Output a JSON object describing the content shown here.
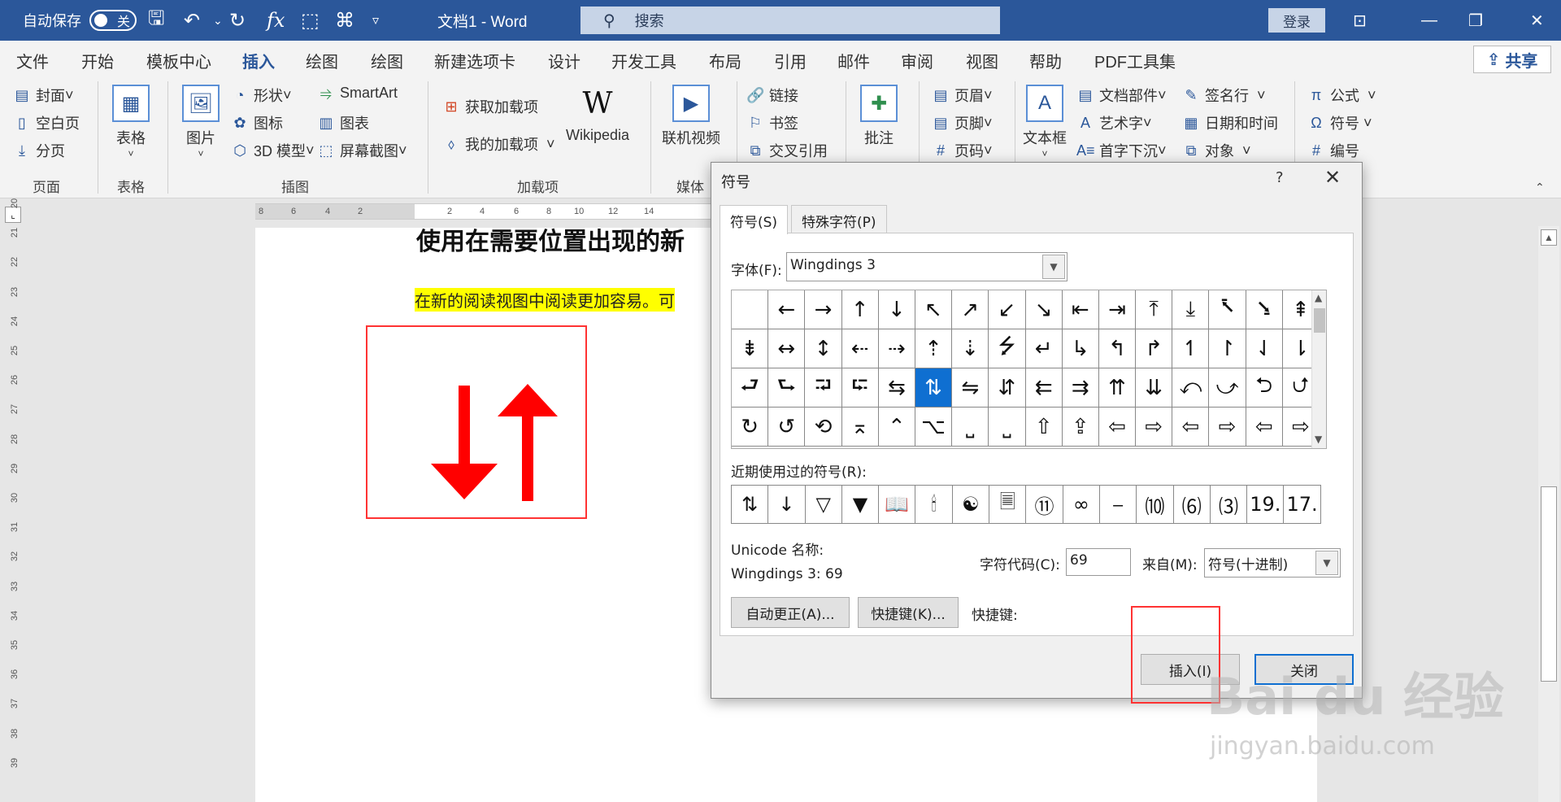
{
  "titlebar": {
    "autosave_label": "自动保存",
    "autosave_state": "关",
    "doc_title": "文档1  -  Word",
    "search_placeholder": "搜索",
    "login_label": "登录"
  },
  "tabs": [
    "文件",
    "开始",
    "模板中心",
    "插入",
    "绘图",
    "绘图",
    "新建选项卡",
    "设计",
    "开发工具",
    "布局",
    "引用",
    "邮件",
    "审阅",
    "视图",
    "帮助",
    "PDF工具集"
  ],
  "active_tab": "插入",
  "share_label": "共享",
  "ribbon": {
    "pages": {
      "cover": "封面",
      "blank": "空白页",
      "break": "分页",
      "group": "页面"
    },
    "tables": {
      "table": "表格",
      "group": "表格"
    },
    "illustrations": {
      "picture": "图片",
      "shapes": "形状",
      "icons": "图标",
      "model3d": "3D 模型",
      "smartart": "SmartArt",
      "chart": "图表",
      "screenshot": "屏幕截图",
      "group": "插图"
    },
    "addins": {
      "get": "获取加载项",
      "my": "我的加载项",
      "wikipedia": "Wikipedia",
      "group": "加载项"
    },
    "media": {
      "video": "联机视频",
      "group": "媒体"
    },
    "links": {
      "link": "链接",
      "bookmark": "书签",
      "crossref": "交叉引用"
    },
    "comments": {
      "comment": "批注"
    },
    "headerfooter": {
      "header": "页眉",
      "footer": "页脚",
      "pagenum": "页码"
    },
    "text": {
      "textbox": "文本框",
      "quickparts": "文档部件",
      "wordart": "艺术字",
      "dropcap": "首字下沉",
      "sigline": "签名行",
      "datetime": "日期和时间",
      "object": "对象"
    },
    "symbols": {
      "equation": "公式",
      "symbol": "符号",
      "number": "编号"
    }
  },
  "document": {
    "heading": "使用在需要位置出现的新",
    "highlighted_text": "在新的阅读视图中阅读更加容易。可"
  },
  "vruler_numbers": [
    "20",
    "21",
    "22",
    "23",
    "24",
    "25",
    "26",
    "27",
    "28",
    "29",
    "30",
    "31",
    "32",
    "33",
    "34",
    "35",
    "36",
    "37",
    "38",
    "39"
  ],
  "hruler_numbers": [
    "8",
    "6",
    "4",
    "2",
    "2",
    "4",
    "6",
    "8",
    "10",
    "12",
    "14"
  ],
  "dialog": {
    "title": "符号",
    "help": "?",
    "tab_symbols": "符号(S)",
    "tab_special": "特殊字符(P)",
    "font_label": "字体(F):",
    "font_value": "Wingdings 3",
    "symbols": [
      "",
      "←",
      "→",
      "↑",
      "↓",
      "↖",
      "↗",
      "↙",
      "↘",
      "⇤",
      "⇥",
      "⤒",
      "⤓",
      "⭶",
      "⭸",
      "⇞",
      "⇟",
      "↔",
      "↕",
      "⇠",
      "⇢",
      "⇡",
      "⇣",
      "⭍",
      "↵",
      "↳",
      "↰",
      "↱",
      "↿",
      "↾",
      "⇃",
      "⇂",
      "⮐",
      "⮑",
      "⮒",
      "⮓",
      "⇆",
      "⇅",
      "⇋",
      "⇵",
      "⇇",
      "⇉",
      "⇈",
      "⇊",
      "⤺",
      "⤻",
      "⮌",
      "⮍",
      "↻",
      "↺",
      "⟲",
      "⌅",
      "⌃",
      "⌥",
      "⎵",
      "⎵",
      "⇧",
      "⇪",
      "⇦",
      "⇨",
      "⇦",
      "⇨",
      "⇦",
      "⇨"
    ],
    "selected_index": 37,
    "recent_label": "近期使用过的符号(R):",
    "recent": [
      "⇅",
      "↓",
      "▽",
      "▼",
      "📖",
      "🕯",
      "☯",
      "🗏",
      "⑪",
      "∞",
      "⎯",
      "⑽",
      "⑹",
      "⑶",
      "19.",
      "17."
    ],
    "unicode_label": "Unicode 名称:",
    "unicode_value": "Wingdings 3: 69",
    "code_label": "字符代码(C):",
    "code_value": "69",
    "from_label": "来自(M):",
    "from_value": "符号(十进制)",
    "autocorrect_btn": "自动更正(A)...",
    "shortcut_btn": "快捷键(K)...",
    "shortcut_label": "快捷键:",
    "insert_btn": "插入(I)",
    "close_btn": "关闭"
  },
  "watermark": {
    "main": "Bai du 经验",
    "sub": "jingyan.baidu.com"
  },
  "colors": {
    "accent": "#2b579a",
    "highlight": "#ffff00",
    "red": "#ff0000",
    "selection": "#0f6fd1"
  }
}
